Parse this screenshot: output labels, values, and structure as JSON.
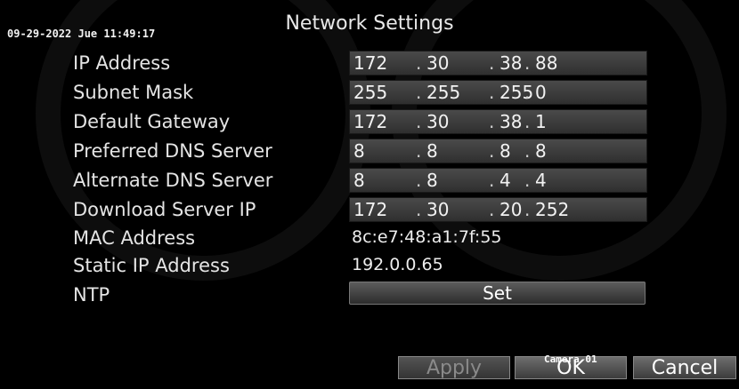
{
  "osd": {
    "timestamp": "09-29-2022 Jue 11:49:17",
    "camera": "Camera 01"
  },
  "title": "Network Settings",
  "fields": [
    {
      "label": "IP Address",
      "octets": [
        "172",
        "30",
        "38",
        "88"
      ]
    },
    {
      "label": "Subnet Mask",
      "octets": [
        "255",
        "255",
        "255",
        "0"
      ]
    },
    {
      "label": "Default Gateway",
      "octets": [
        "172",
        "30",
        "38",
        "1"
      ]
    },
    {
      "label": "Preferred DNS Server",
      "octets": [
        "8",
        "8",
        "8",
        "8"
      ]
    },
    {
      "label": "Alternate DNS Server",
      "octets": [
        "8",
        "8",
        "4",
        "4"
      ]
    },
    {
      "label": "Download Server IP",
      "octets": [
        "172",
        "30",
        "20",
        "252"
      ]
    }
  ],
  "mac": {
    "label": "MAC Address",
    "value": "8c:e7:48:a1:7f:55"
  },
  "static_ip": {
    "label": "Static IP Address",
    "value": "192.0.0.65"
  },
  "ntp": {
    "label": "NTP",
    "button": "Set"
  },
  "buttons": {
    "apply": "Apply",
    "ok": "OK",
    "cancel": "Cancel"
  },
  "colors": {
    "background": "#000000",
    "field": "#3c3c3c",
    "text": "#ffffff"
  }
}
